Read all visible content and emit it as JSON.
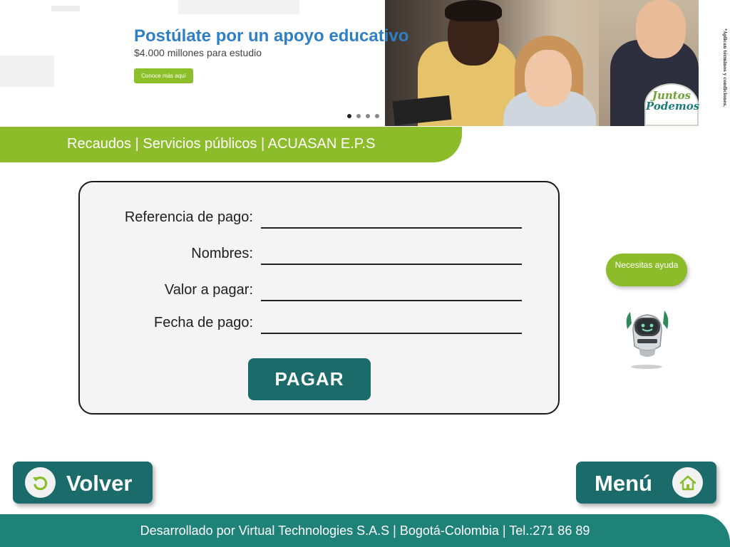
{
  "banner": {
    "title": "Postúlate por un apoyo educativo",
    "subtitle": "$4.000 millones para estudio",
    "cta_label": "Conoce más aquí",
    "stamp_line1": "Juntos",
    "stamp_line2": "Podemos",
    "terms": "*Aplican términos y condiciones.",
    "carousel_dots": 4,
    "carousel_active": 1
  },
  "breadcrumb": {
    "text": "Recaudos | Servicios públicos | ACUASAN E.P.S"
  },
  "form": {
    "fields": [
      {
        "label": "Referencia de pago:",
        "value": ""
      },
      {
        "label": "Nombres:",
        "value": ""
      },
      {
        "label": "Valor a pagar:",
        "value": ""
      },
      {
        "label": "Fecha de pago:",
        "value": ""
      }
    ],
    "submit_label": "PAGAR"
  },
  "help": {
    "label": "Necesitas ayuda"
  },
  "nav": {
    "back_label": "Volver",
    "back_icon": "undo-icon",
    "menu_label": "Menú",
    "menu_icon": "home-icon"
  },
  "footer": {
    "text": "Desarrollado por Virtual Technologies S.A.S | Bogotá-Colombia | Tel.:271 86 89"
  },
  "colors": {
    "brand_green": "#8cbc29",
    "brand_teal": "#1b6b6b",
    "footer_teal": "#1f8279",
    "title_blue": "#2f7fc4"
  }
}
